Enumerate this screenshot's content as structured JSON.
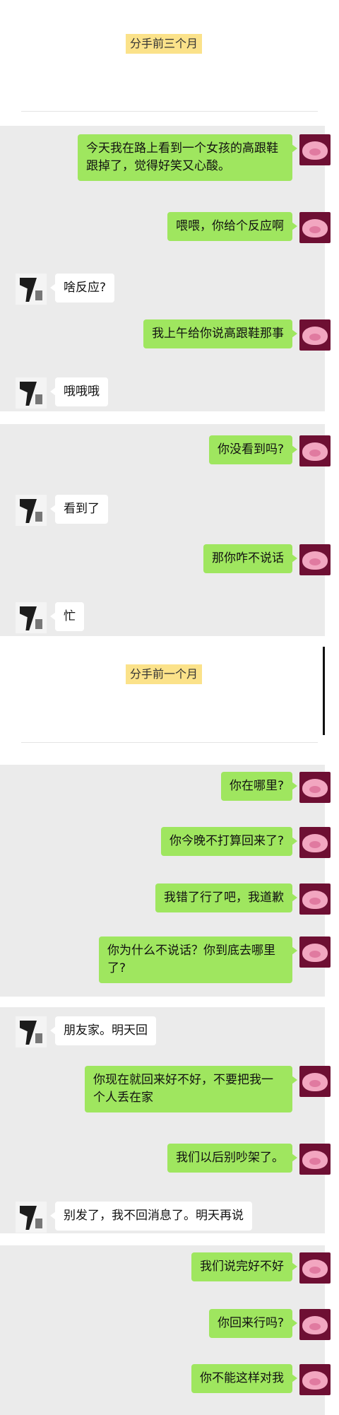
{
  "sections": [
    {
      "tag": "分手前三个月"
    },
    {
      "tag": "分手前一个月"
    }
  ],
  "messages": [
    {
      "text": "今天我在路上看到一个女孩的高跟鞋跟掉了，觉得好笑又心酸。"
    },
    {
      "text": "喂喂，你给个反应啊"
    },
    {
      "text": "啥反应?"
    },
    {
      "text": "我上午给你说高跟鞋那事"
    },
    {
      "text": "哦哦哦"
    },
    {
      "text": "你没看到吗?"
    },
    {
      "text": "看到了"
    },
    {
      "text": "那你咋不说话"
    },
    {
      "text": "忙"
    },
    {
      "text": "你在哪里?"
    },
    {
      "text": "你今晚不打算回来了?"
    },
    {
      "text": "我错了行了吧，我道歉"
    },
    {
      "text": "你为什么不说话？你到底去哪里了?"
    },
    {
      "text": "朋友家。明天回"
    },
    {
      "text": "你现在就回来好不好，不要把我一个人丢在家"
    },
    {
      "text": "我们以后别吵架了。"
    },
    {
      "text": "别发了，我不回消息了。明天再说"
    },
    {
      "text": "我们说完好不好"
    },
    {
      "text": "你回来行吗?"
    },
    {
      "text": "你不能这样对我"
    }
  ],
  "colors": {
    "outgoing_bubble": "#9fe65f",
    "incoming_bubble": "#ffffff",
    "chat_bg": "#ebebeb",
    "section_tag": "#fbe28a"
  }
}
